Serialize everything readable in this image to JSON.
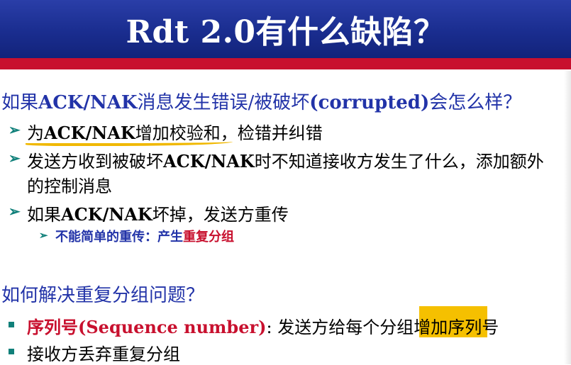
{
  "header": {
    "title": "Rdt 2.0有什么缺陷？"
  },
  "section1": {
    "question_prefix": "如果",
    "question_bold": "ACK/NAK",
    "question_mid": "消息发生错误/被破坏",
    "question_bold2": "(corrupted)",
    "question_end": "会怎么样？",
    "items": [
      {
        "pre": "为",
        "bold": "ACK/NAK",
        "post": "增加校验和，检错并纠错"
      },
      {
        "pre": "发送方收到被破坏",
        "bold": "ACK/NAK",
        "post": "时不知道接收方发生了什么，添加额外",
        "cont": "的控制消息"
      },
      {
        "pre": "如果",
        "bold": "ACK/NAK",
        "post": "坏掉，发送方重传"
      }
    ],
    "sub_item": {
      "pre": "不能简单的重传：产生",
      "red": "重复分组"
    }
  },
  "section2": {
    "question": "如何解决重复分组问题？",
    "items": [
      {
        "red": "序列号(Sequence number)",
        "post": ": 发送方给每个分组增加序列号"
      },
      {
        "post": "接收方丢弃重复分组"
      }
    ]
  },
  "colors": {
    "title_bar": "#1a2d8f",
    "accent_red": "#c8102e",
    "question_blue": "#2233a8",
    "bullet_teal": "#10807a",
    "highlight_yellow": "#f5c000"
  }
}
